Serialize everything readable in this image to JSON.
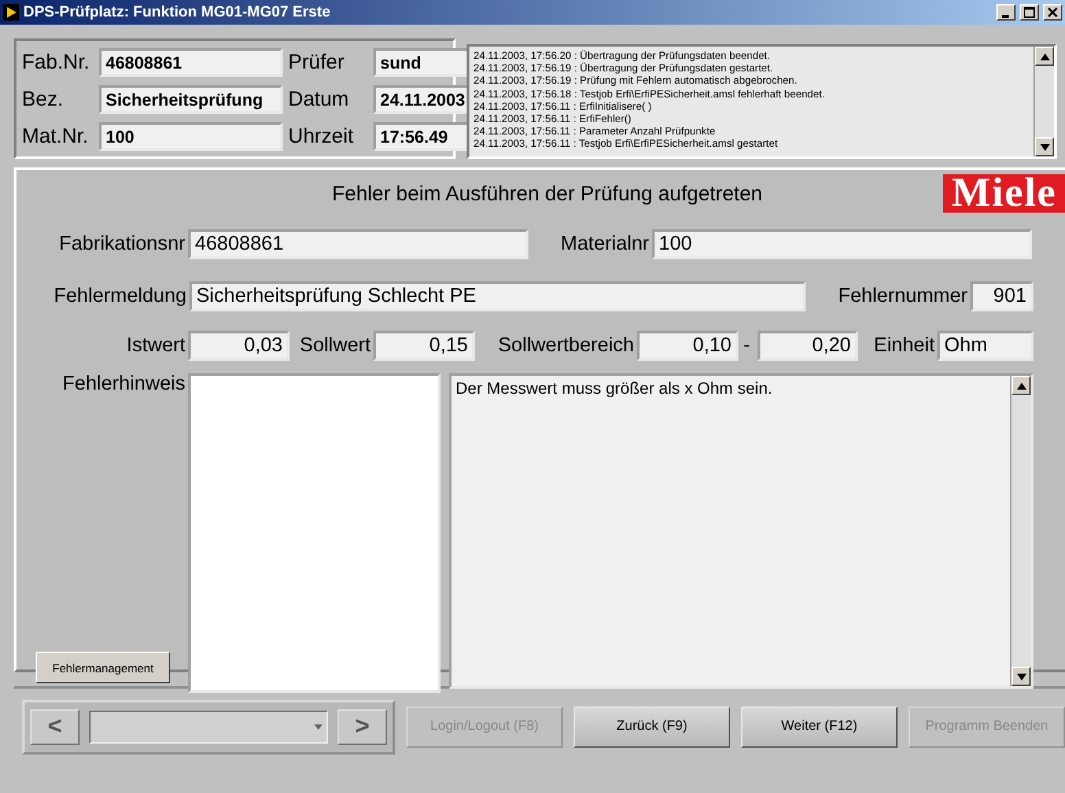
{
  "window": {
    "title": "DPS-Prüfplatz: Funktion MG01-MG07 Erste"
  },
  "header": {
    "fields": [
      {
        "label": "Fab.Nr.",
        "value": "46808861"
      },
      {
        "label": "Prüfer",
        "value": "sund"
      },
      {
        "label": "Bez.",
        "value": "Sicherheitsprüfung"
      },
      {
        "label": "Datum",
        "value": "24.11.2003"
      },
      {
        "label": "Mat.Nr.",
        "value": "100"
      },
      {
        "label": "Uhrzeit",
        "value": "17:56.49"
      }
    ],
    "log": [
      "24.11.2003, 17:56.20 : Übertragung der Prüfungsdaten beendet.",
      "24.11.2003, 17:56.19 : Übertragung der Prüfungsdaten gestartet.",
      "24.11.2003, 17:56.19 : Prüfung mit Fehlern automatisch abgebrochen.",
      "24.11.2003, 17:56.18 : Testjob Erfi\\ErfiPESicherheit.amsl fehlerhaft beendet.",
      "24.11.2003, 17:56.11 : ErfiInitialisere( )",
      "24.11.2003, 17:56.11 : ErfiFehler()",
      "24.11.2003, 17:56.11 : Parameter Anzahl Prüfpunkte",
      "24.11.2003, 17:56.11 : Testjob Erfi\\ErfiPESicherheit.amsl gestartet"
    ]
  },
  "main": {
    "heading": "Fehler beim Ausführen der Prüfung aufgetreten",
    "logo": "Miele",
    "fabrikationsnr": {
      "label": "Fabrikationsnr",
      "value": "46808861"
    },
    "materialnr": {
      "label": "Materialnr",
      "value": "100"
    },
    "fehlermeldung": {
      "label": "Fehlermeldung",
      "value": "Sicherheitsprüfung Schlecht PE"
    },
    "fehlernummer": {
      "label": "Fehlernummer",
      "value": "901"
    },
    "istwert": {
      "label": "Istwert",
      "value": "0,03"
    },
    "sollwert": {
      "label": "Sollwert",
      "value": "0,15"
    },
    "sollwertbereich": {
      "label": "Sollwertbereich",
      "from": "0,10",
      "separator": "-",
      "to": "0,20"
    },
    "einheit": {
      "label": "Einheit",
      "value": "Ohm"
    },
    "fehlerhinweis": {
      "label": "Fehlerhinweis",
      "text": "Der Messwert muss größer als x Ohm sein."
    },
    "button": {
      "label": "Fehlermanagement"
    }
  },
  "bottom": {
    "prev": "<",
    "next": ">",
    "buttons": [
      {
        "label": "Login/Logout (F8)",
        "disabled": true
      },
      {
        "label": "Zurück (F9)",
        "disabled": false
      },
      {
        "label": "Weiter (F12)",
        "disabled": false
      },
      {
        "label": "Programm Beenden",
        "disabled": true
      }
    ]
  }
}
